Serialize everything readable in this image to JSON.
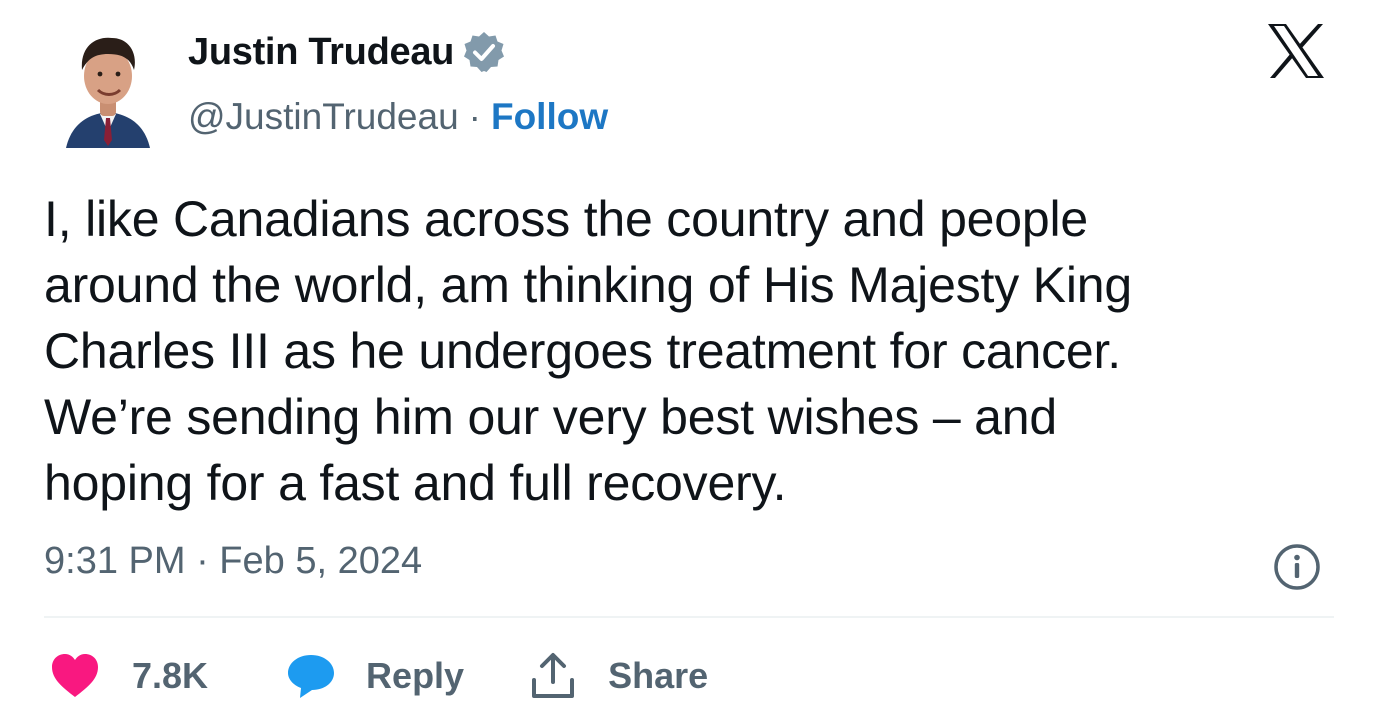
{
  "author": {
    "display_name": "Justin Trudeau",
    "handle": "@JustinTrudeau",
    "separator": "·",
    "follow_label": "Follow",
    "verified_icon": "verified-badge-icon"
  },
  "brand": {
    "logo_icon": "x-logo-icon"
  },
  "tweet": {
    "text": "I, like Canadians across the country and people\naround the world, am thinking of His Majesty King\nCharles III as he undergoes treatment for cancer.\nWe’re sending him our very best wishes – and\nhoping for a fast and full recovery.",
    "timestamp": "9:31 PM · Feb 5, 2024"
  },
  "actions": {
    "likes_count": "7.8K",
    "reply_label": "Reply",
    "share_label": "Share"
  },
  "colors": {
    "text": "#0f1419",
    "secondary": "#536471",
    "follow_blue": "#1d77c4",
    "heart_pink": "#f91880",
    "reply_blue": "#1d9bf0",
    "verified_grey": "#829aab"
  }
}
